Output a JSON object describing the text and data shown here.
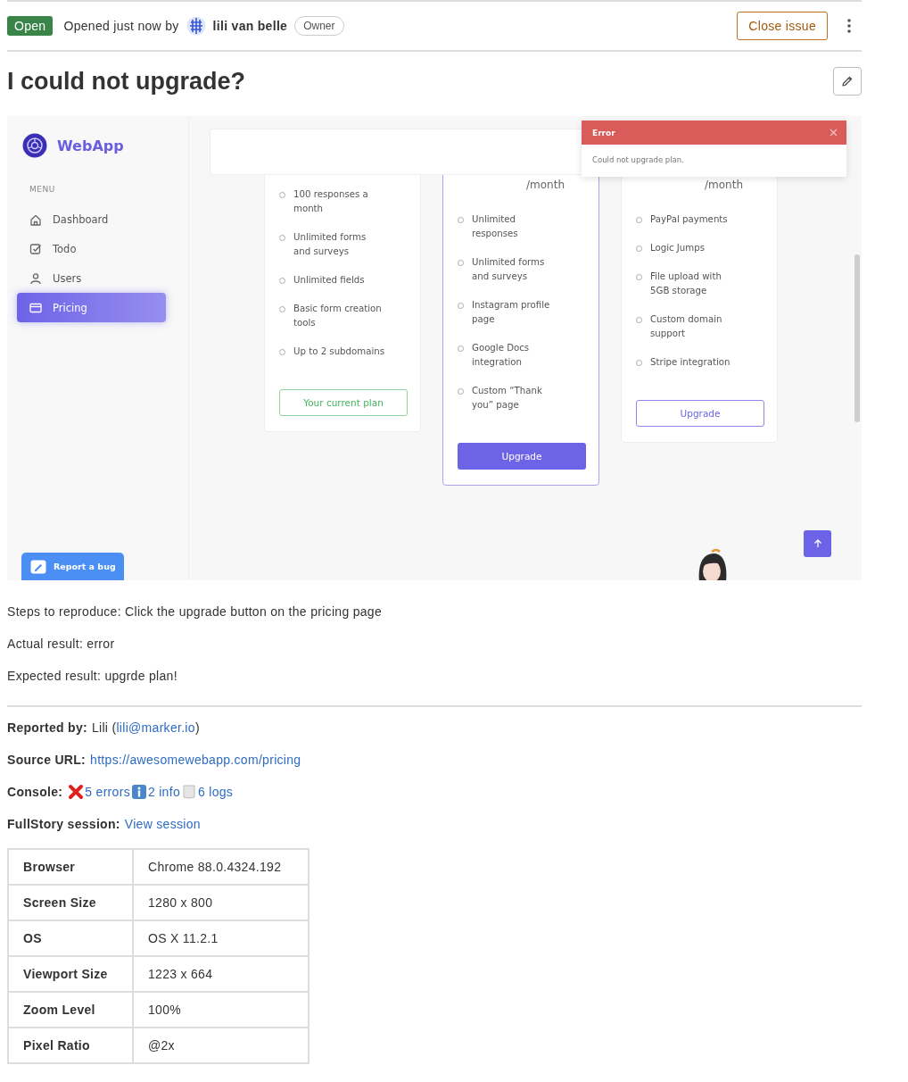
{
  "issue_header": {
    "status": "Open",
    "meta": "Opened just now by",
    "author": "lili van belle",
    "role": "Owner",
    "close_button": "Close issue"
  },
  "title": "I could not upgrade?",
  "screenshot": {
    "app_name": "WebApp",
    "menu_label": "MENU",
    "menu": [
      {
        "label": "Dashboard",
        "selected": false
      },
      {
        "label": "Todo",
        "selected": false
      },
      {
        "label": "Users",
        "selected": false
      },
      {
        "label": "Pricing",
        "selected": true
      }
    ],
    "report_button": "Report a bug",
    "plans": [
      {
        "featured": false,
        "features": [
          "100 responses a month",
          "Unlimited forms and surveys",
          "Unlimited fields",
          "Basic form creation tools",
          "Up to 2 subdomains"
        ],
        "button": {
          "label": "Your current plan",
          "kind": "current"
        }
      },
      {
        "featured": true,
        "price_unit": "/month",
        "features": [
          "Unlimited responses",
          "Unlimited forms and surveys",
          "Instagram profile page",
          "Google Docs integration",
          "Custom “Thank you” page"
        ],
        "button": {
          "label": "Upgrade",
          "kind": "primary"
        }
      },
      {
        "featured": false,
        "price_unit": "/month",
        "features": [
          "PayPal payments",
          "Logic Jumps",
          "File upload with 5GB storage",
          "Custom domain support",
          "Stripe integration"
        ],
        "button": {
          "label": "Upgrade",
          "kind": "outline"
        }
      }
    ],
    "toast": {
      "title": "Error",
      "message": "Could not upgrade plan."
    }
  },
  "description": [
    "Steps to reproduce: Click the upgrade button on the pricing page",
    "Actual result: error",
    "Expected result: upgrde plan!"
  ],
  "details": [
    {
      "label": "Reported by:",
      "parts": [
        {
          "kind": "text",
          "text": "Lili ("
        },
        {
          "kind": "link",
          "text": "lili@marker.io"
        },
        {
          "kind": "text",
          "text": ")"
        }
      ]
    },
    {
      "label": "Source URL:",
      "parts": [
        {
          "kind": "link",
          "text": "https://awesomewebapp.com/pricing"
        }
      ]
    },
    {
      "label": "Console:",
      "parts": [
        {
          "kind": "error-icon"
        },
        {
          "kind": "link",
          "text": "5 errors"
        },
        {
          "kind": "info-icon"
        },
        {
          "kind": "link",
          "text": "2 info"
        },
        {
          "kind": "log-icon"
        },
        {
          "kind": "link",
          "text": "6 logs"
        }
      ]
    },
    {
      "label": "FullStory session:",
      "parts": [
        {
          "kind": "link",
          "text": "View session"
        }
      ]
    }
  ],
  "environment": [
    {
      "label": "Browser",
      "value": "Chrome 88.0.4324.192"
    },
    {
      "label": "Screen Size",
      "value": "1280 x 800"
    },
    {
      "label": "OS",
      "value": "OS X 11.2.1"
    },
    {
      "label": "Viewport Size",
      "value": "1223 x 664"
    },
    {
      "label": "Zoom Level",
      "value": "100%"
    },
    {
      "label": "Pixel Ratio",
      "value": "@2x"
    }
  ]
}
